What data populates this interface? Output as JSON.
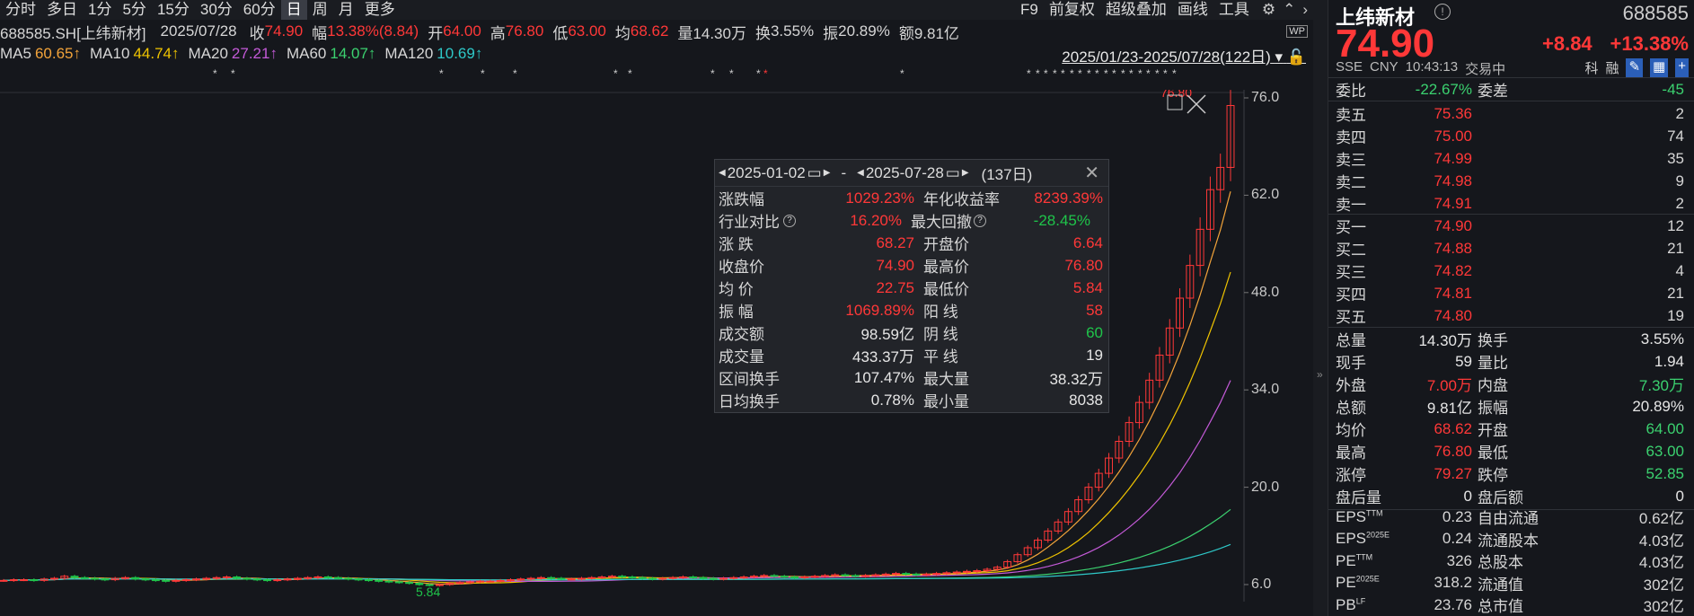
{
  "toolbar": {
    "periods": [
      "分时",
      "多日",
      "1分",
      "5分",
      "15分",
      "30分",
      "60分",
      "日",
      "周",
      "月",
      "更多"
    ],
    "active": "日",
    "right": [
      "F9",
      "前复权",
      "超级叠加",
      "画线",
      "工具"
    ]
  },
  "info": {
    "code": "688585.SH[上纬新材]",
    "date": "2025/07/28",
    "close_label": "收",
    "close": "74.90",
    "amp_label": "幅",
    "amp": "13.38%(8.84)",
    "open_label": "开",
    "open": "64.00",
    "high_label": "高",
    "high": "76.80",
    "low_label": "低",
    "low": "63.00",
    "avg_label": "均",
    "avg": "68.62",
    "vol_label": "量",
    "vol": "14.30万",
    "turn_label": "换",
    "turn": "3.55%",
    "swing_label": "振",
    "swing": "20.89%",
    "amt_label": "额",
    "amt": "9.81亿"
  },
  "ma": {
    "ma5_label": "MA5",
    "ma5": "60.65↑",
    "ma10_label": "MA10",
    "ma10": "44.74↑",
    "ma20_label": "MA20",
    "ma20": "27.21↑",
    "ma60_label": "MA60",
    "ma60": "14.07↑",
    "ma120_label": "MA120",
    "ma120": "10.69↑",
    "range": "2025/01/23-2025/07/28(122日)"
  },
  "chart_data": {
    "type": "candlestick",
    "y_ticks": [
      "76.0",
      "62.0",
      "48.0",
      "34.0",
      "20.0",
      "6.0"
    ],
    "high_label": "76.80",
    "low_label": "5.84",
    "ylim": [
      6,
      76
    ],
    "closes": [
      6.6,
      6.7,
      6.7,
      6.6,
      6.8,
      6.9,
      7.2,
      7.0,
      6.9,
      6.8,
      6.7,
      6.9,
      7.0,
      6.8,
      6.7,
      6.6,
      6.5,
      6.6,
      6.7,
      6.8,
      6.9,
      7.0,
      7.1,
      6.9,
      6.8,
      6.7,
      6.6,
      6.7,
      6.8,
      6.9,
      7.0,
      7.1,
      7.0,
      6.9,
      6.8,
      6.7,
      6.6,
      6.5,
      6.4,
      6.3,
      6.2,
      6.0,
      5.9,
      6.0,
      6.2,
      6.3,
      6.4,
      6.5,
      6.5,
      6.6,
      6.7,
      6.8,
      6.9,
      7.0,
      6.9,
      6.8,
      6.8,
      6.9,
      7.0,
      7.1,
      7.2,
      7.1,
      7.0,
      6.9,
      6.8,
      6.9,
      7.0,
      7.1,
      7.0,
      6.9,
      6.8,
      6.9,
      7.0,
      7.1,
      7.2,
      7.3,
      7.2,
      7.1,
      7.0,
      7.1,
      7.2,
      7.3,
      7.4,
      7.3,
      7.2,
      7.3,
      7.4,
      7.5,
      7.6,
      7.5,
      7.4,
      7.5,
      7.6,
      7.7,
      7.8,
      7.9,
      8.0,
      8.2,
      8.5,
      9.3,
      10.3,
      11.3,
      12.4,
      13.7,
      15.0,
      16.5,
      18.2,
      20.0,
      22.0,
      24.2,
      26.6,
      29.3,
      32.2,
      35.4,
      39.0,
      42.9,
      47.2,
      51.9,
      57.1,
      62.8,
      66.0,
      74.9
    ]
  },
  "popup": {
    "date_from": "2025-01-02",
    "date_to": "2025-07-28",
    "days": "(137日)",
    "dash": "-",
    "rows": [
      [
        "涨跌幅",
        "1029.23%",
        "年化收益率",
        "8239.39%"
      ],
      [
        "行业对比",
        "16.20%",
        "最大回撤",
        "-28.45%"
      ],
      [
        "涨 跌",
        "68.27",
        "开盘价",
        "6.64"
      ],
      [
        "收盘价",
        "74.90",
        "最高价",
        "76.80"
      ],
      [
        "均 价",
        "22.75",
        "最低价",
        "5.84"
      ],
      [
        "振 幅",
        "1069.89%",
        "阳 线",
        "58"
      ],
      [
        "成交额",
        "98.59亿",
        "阴 线",
        "60"
      ],
      [
        "成交量",
        "433.37万",
        "平 线",
        "19"
      ],
      [
        "区间换手",
        "107.47%",
        "最大量",
        "38.32万"
      ],
      [
        "日均换手",
        "0.78%",
        "最小量",
        "8038"
      ]
    ]
  },
  "quote": {
    "name": "上纬新材",
    "code": "688585",
    "price": "74.90",
    "change": "+8.84",
    "pct": "+13.38%",
    "exchange": "SSE",
    "currency": "CNY",
    "time": "10:43:13",
    "status": "交易中",
    "tabs": [
      "科",
      "融"
    ],
    "wb_label": "委比",
    "wb": "-22.67%",
    "wc_label": "委差",
    "wc": "-45",
    "asks": [
      [
        "卖五",
        "75.36",
        "2"
      ],
      [
        "卖四",
        "75.00",
        "74"
      ],
      [
        "卖三",
        "74.99",
        "35"
      ],
      [
        "卖二",
        "74.98",
        "9"
      ],
      [
        "卖一",
        "74.91",
        "2"
      ]
    ],
    "bids": [
      [
        "买一",
        "74.90",
        "12"
      ],
      [
        "买二",
        "74.88",
        "21"
      ],
      [
        "买三",
        "74.82",
        "4"
      ],
      [
        "买四",
        "74.81",
        "21"
      ],
      [
        "买五",
        "74.80",
        "19"
      ]
    ],
    "stats": [
      [
        "总量",
        "14.30万",
        "换手",
        "3.55%"
      ],
      [
        "现手",
        "59",
        "量比",
        "1.94"
      ],
      [
        "外盘",
        "7.00万",
        "内盘",
        "7.30万"
      ],
      [
        "总额",
        "9.81亿",
        "振幅",
        "20.89%"
      ],
      [
        "均价",
        "68.62",
        "开盘",
        "64.00"
      ],
      [
        "最高",
        "76.80",
        "最低",
        "63.00"
      ],
      [
        "涨停",
        "79.27",
        "跌停",
        "52.85"
      ],
      [
        "盘后量",
        "0",
        "盘后额",
        "0"
      ]
    ],
    "fin": [
      [
        "EPS",
        "TTM",
        "0.23",
        "自由流通",
        "0.62亿"
      ],
      [
        "EPS",
        "2025E",
        "0.24",
        "流通股本",
        "4.03亿"
      ],
      [
        "PE",
        "TTM",
        "326",
        "总股本",
        "4.03亿"
      ],
      [
        "PE",
        "2025E",
        "318.2",
        "流通值",
        "302亿"
      ],
      [
        "PB",
        "LF",
        "23.76",
        "总市值",
        "302亿"
      ]
    ]
  }
}
